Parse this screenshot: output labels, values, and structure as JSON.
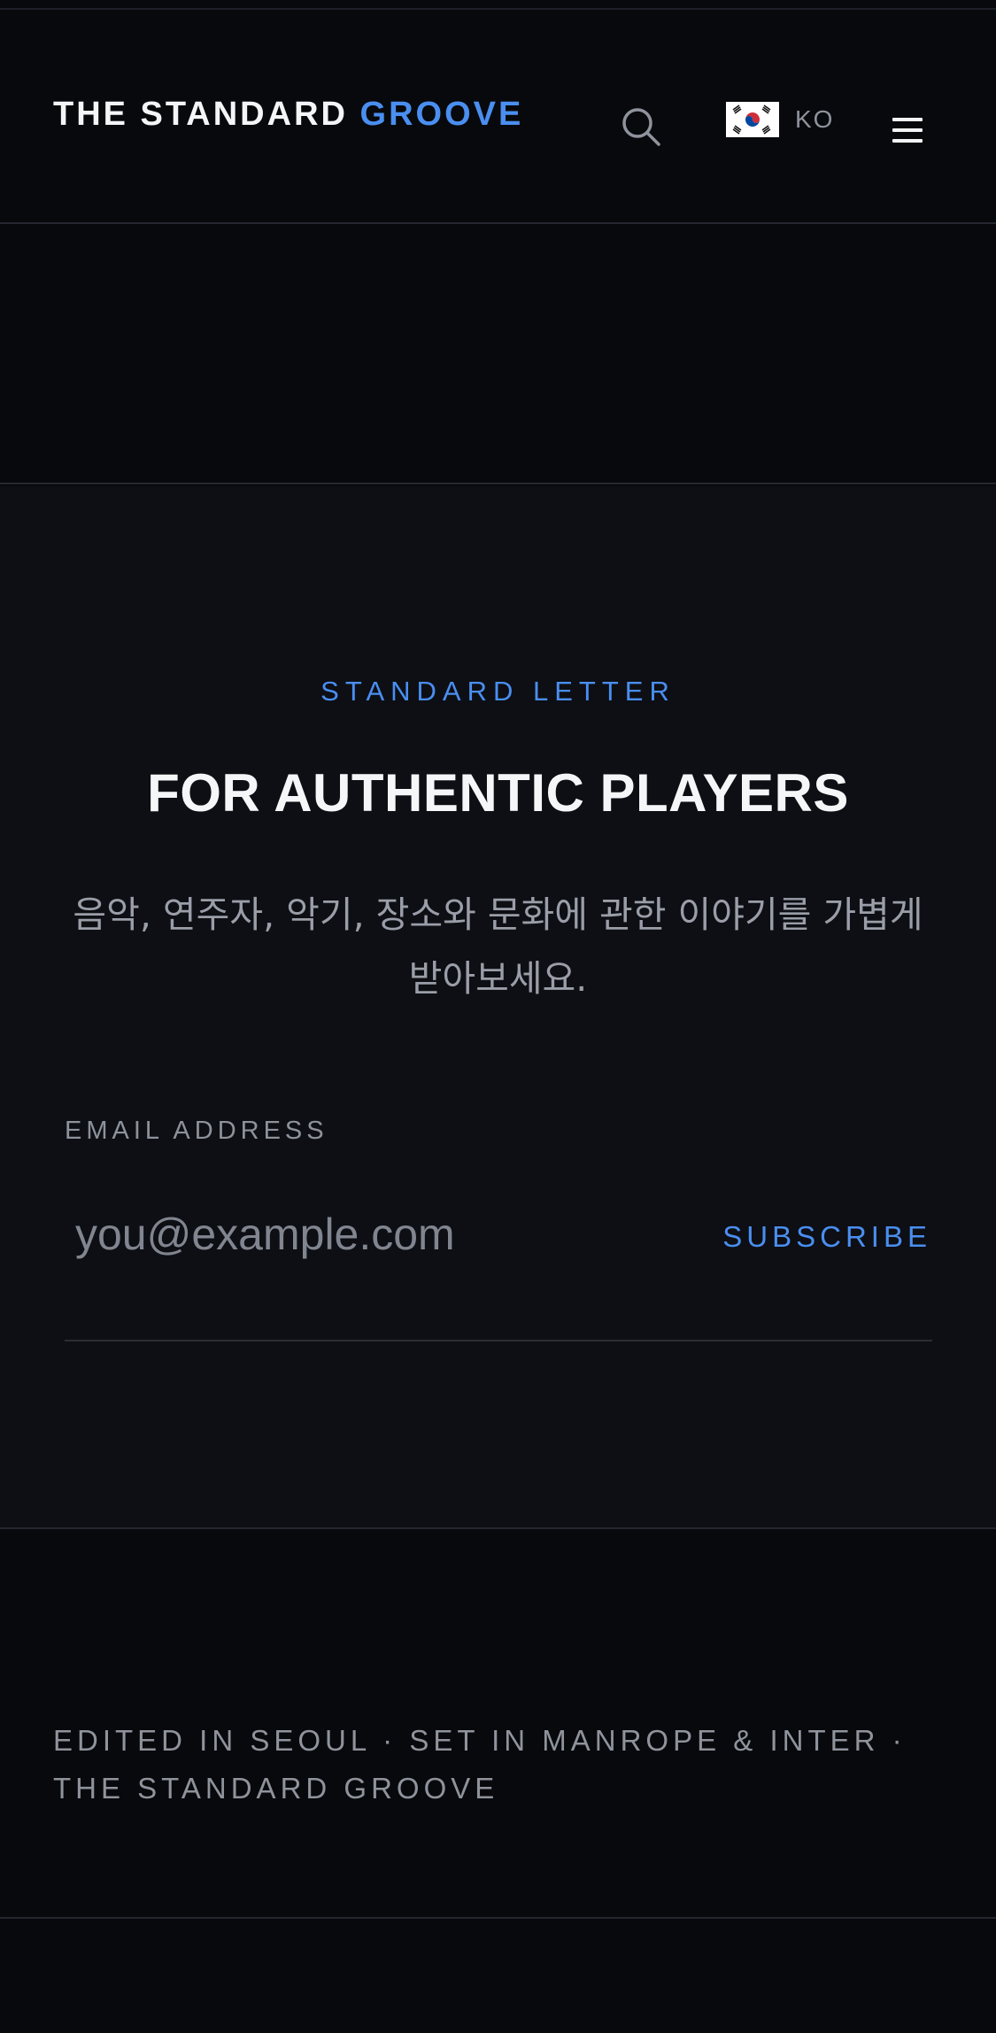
{
  "header": {
    "logo_main": "THE STANDARD ",
    "logo_accent": "GROOVE",
    "search_icon": "search-icon",
    "language": {
      "flag_icon": "korea-flag-icon",
      "code": "KO"
    },
    "menu_icon": "hamburger-menu-icon"
  },
  "newsletter": {
    "eyebrow": "STANDARD LETTER",
    "headline": "FOR AUTHENTIC PLAYERS",
    "description": "음악, 연주자, 악기, 장소와 문화에 관한 이야기를 가볍게 받아보세요.",
    "email_label": "EMAIL ADDRESS",
    "email_placeholder": "you@example.com",
    "email_value": "",
    "subscribe_label": "SUBSCRIBE"
  },
  "footer": {
    "colophon": "EDITED IN SEOUL · SET IN MANROPE & INTER · THE STANDARD GROOVE"
  },
  "colors": {
    "background": "#08090c",
    "panel": "#0d0f14",
    "accent": "#4a8ef0",
    "text_primary": "#f5f6f8",
    "text_muted": "#8e939c"
  }
}
